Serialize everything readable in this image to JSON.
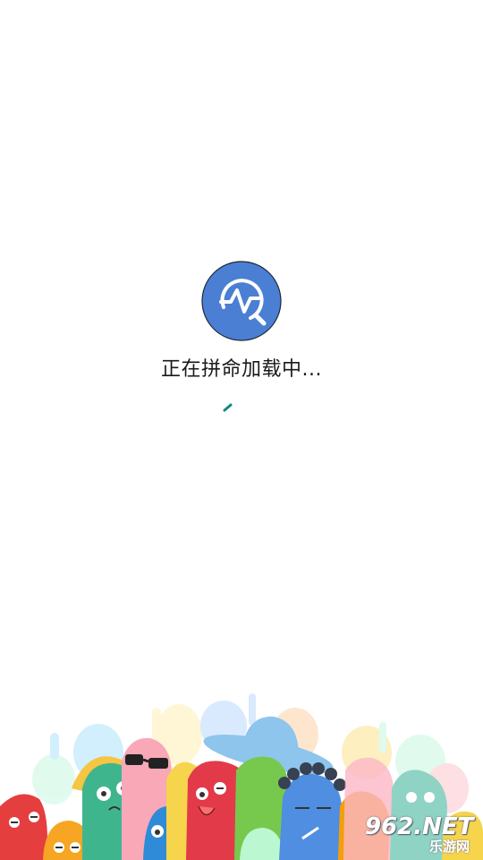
{
  "loading": {
    "message": "正在拼命加载中..."
  },
  "logo": {
    "icon": "pulse-search-icon",
    "color": "#4a7fd4"
  },
  "spinner": {
    "color": "#0f8a7e"
  },
  "watermark": {
    "main": "962.NET",
    "sub": "乐游网"
  }
}
